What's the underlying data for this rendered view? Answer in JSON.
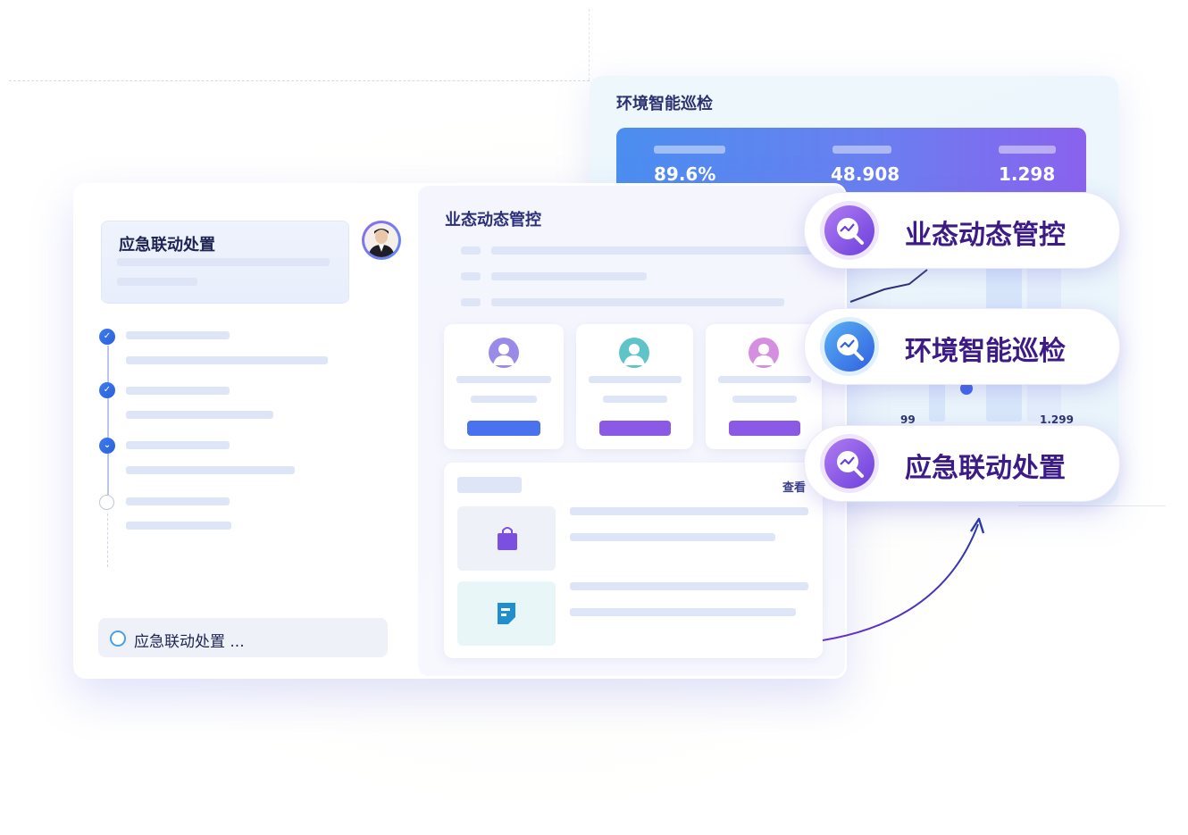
{
  "environment_panel": {
    "title": "环境智能巡检",
    "stats": [
      "89.6%",
      "48.908",
      "1.298"
    ],
    "bottom_values": [
      "99",
      "1.299"
    ]
  },
  "sidebar": {
    "header_title": "应急联动处置",
    "steps": [
      {
        "state": "done"
      },
      {
        "state": "done"
      },
      {
        "state": "active"
      },
      {
        "state": "pending"
      }
    ],
    "input_text": "应急联动处置 ..."
  },
  "main": {
    "title": "业态动态管控",
    "person_cards": [
      {
        "avatar_color": "#9a8be8",
        "button_color": "#4b72ee"
      },
      {
        "avatar_color": "#5ec4c8",
        "button_color": "#8a5ae6"
      },
      {
        "avatar_color": "#d58fe0",
        "button_color": "#8a5ae6"
      }
    ],
    "list": {
      "view_label": "查看",
      "items": [
        {
          "icon": "shopping-bag-icon",
          "color": "#7b4fe0"
        },
        {
          "icon": "document-icon",
          "color": "#1f8fd0"
        }
      ]
    }
  },
  "features": [
    {
      "label": "业态动态管控",
      "icon": "search-analytics-icon",
      "color_from": "#b07cf2",
      "color_to": "#6b3fdc"
    },
    {
      "label": "环境智能巡检",
      "icon": "search-analytics-icon",
      "color_from": "#5ab0f4",
      "color_to": "#2f60e0"
    },
    {
      "label": "应急联动处置",
      "icon": "search-analytics-icon",
      "color_from": "#b07cf2",
      "color_to": "#6b3fdc"
    }
  ]
}
